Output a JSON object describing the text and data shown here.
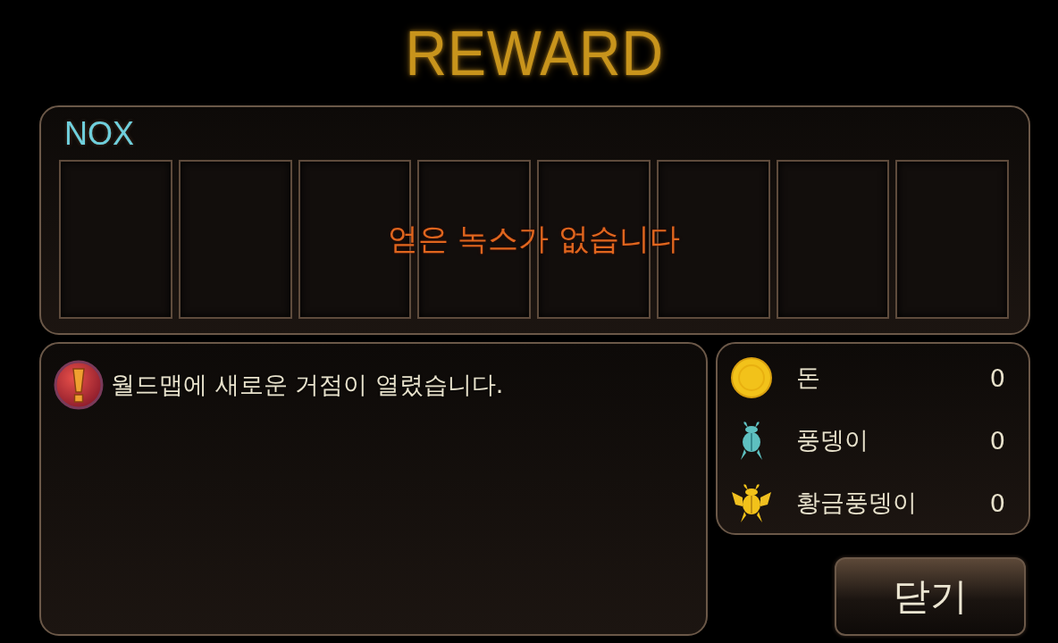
{
  "title": "REWARD",
  "nox": {
    "label": "NOX",
    "slots": [
      {
        "kind": "empty"
      },
      {
        "kind": "empty"
      },
      {
        "kind": "empty"
      },
      {
        "kind": "empty"
      },
      {
        "kind": "empty"
      },
      {
        "kind": "empty"
      },
      {
        "kind": "empty"
      },
      {
        "kind": "empty"
      }
    ],
    "empty_message": "얻은 녹스가 없습니다"
  },
  "messages": [
    {
      "kind": "alert",
      "text": "월드맵에 새로운 거점이 열렸습니다."
    }
  ],
  "resources": [
    {
      "kind": "coin",
      "name": "돈",
      "amount": "0"
    },
    {
      "kind": "beetle",
      "name": "풍뎅이",
      "amount": "0"
    },
    {
      "kind": "golden-beetle",
      "name": "황금풍뎅이",
      "amount": "0"
    }
  ],
  "close_button": "닫기"
}
